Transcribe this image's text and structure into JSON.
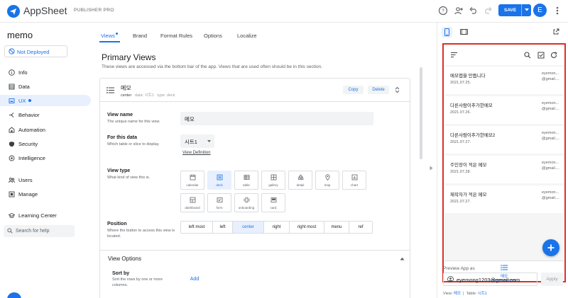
{
  "header": {
    "app_name": "AppSheet",
    "plan": "PUBLISHER PRO",
    "save_label": "SAVE",
    "avatar_letter": "E",
    "brand_color": "#1a73e8"
  },
  "sidebar": {
    "app_title": "memo",
    "deploy_status": "Not Deployed",
    "items": [
      {
        "label": "Info",
        "icon": "info-icon"
      },
      {
        "label": "Data",
        "icon": "data-icon"
      },
      {
        "label": "UX",
        "icon": "ux-icon",
        "active": true
      },
      {
        "label": "Behavior",
        "icon": "behavior-icon"
      },
      {
        "label": "Automation",
        "icon": "automation-icon"
      },
      {
        "label": "Security",
        "icon": "shield-icon"
      },
      {
        "label": "Intelligence",
        "icon": "intelligence-icon"
      },
      {
        "label": "Users",
        "icon": "users-icon"
      },
      {
        "label": "Manage",
        "icon": "manage-icon"
      },
      {
        "label": "Learning Center",
        "icon": "learning-icon"
      }
    ],
    "search_placeholder": "Search for help"
  },
  "tabs": [
    {
      "label": "Views"
    },
    {
      "label": "Brand"
    },
    {
      "label": "Format Rules"
    },
    {
      "label": "Options"
    },
    {
      "label": "Localize"
    }
  ],
  "main": {
    "title": "Primary Views",
    "description": "These views are accessed via the bottom bar of the app. Views that are used often should be in this section.",
    "view": {
      "name": "메모",
      "position": "center",
      "data_label": "data:",
      "data_value": "시트1",
      "type_label": "type:",
      "type_value": "deck",
      "copy_label": "Copy",
      "delete_label": "Delete"
    },
    "fields": {
      "view_name_label": "View name",
      "view_name_help": "The unique name for this view.",
      "view_name_value": "메모",
      "for_data_label": "For this data",
      "for_data_help": "Which table or slice to display.",
      "for_data_value": "시트1",
      "view_definition": "View Definition",
      "view_type_label": "View type",
      "view_type_help": "What kind of view this is.",
      "position_label": "Position",
      "position_help": "Where the button to access this view is located."
    },
    "view_types": [
      {
        "label": "calendar",
        "icon": "calendar-icon"
      },
      {
        "label": "deck",
        "icon": "deck-icon",
        "selected": true
      },
      {
        "label": "table",
        "icon": "table-icon"
      },
      {
        "label": "gallery",
        "icon": "gallery-icon"
      },
      {
        "label": "detail",
        "icon": "detail-icon"
      },
      {
        "label": "map",
        "icon": "map-icon"
      },
      {
        "label": "chart",
        "icon": "chart-icon"
      },
      {
        "label": "dashboard",
        "icon": "dashboard-icon"
      },
      {
        "label": "form",
        "icon": "form-icon"
      },
      {
        "label": "onboarding",
        "icon": "onboarding-icon"
      },
      {
        "label": "card",
        "icon": "card-icon"
      }
    ],
    "positions": [
      "left most",
      "left",
      "center",
      "right",
      "right most",
      "menu",
      "ref"
    ],
    "selected_position": "center",
    "view_options": {
      "title": "View Options",
      "sort_label": "Sort by",
      "sort_help": "Sort the rows by one or more columns.",
      "add_label": "Add"
    }
  },
  "preview": {
    "records": [
      {
        "title": "메모앱을 만듭니다",
        "date": "2021.07.25.",
        "email1": "eyemon...",
        "email2": "@gmail...."
      },
      {
        "title": "다른사람이추가한메모",
        "date": "2021.07.26.",
        "email1": "eyemon...",
        "email2": "@gmail...."
      },
      {
        "title": "다른사람이추가한메모2",
        "date": "2021.07.27.",
        "email1": "eyemon...",
        "email2": "@gmail...."
      },
      {
        "title": "주인장이 적은 메모",
        "date": "2021.07.28.",
        "email1": "eyemon...",
        "email2": "@gmail...."
      },
      {
        "title": "제작자가 적은 메모",
        "date": "2021.07.27.",
        "email1": "eyemon...",
        "email2": "@gmail...."
      }
    ],
    "bottom_tab": "메모",
    "preview_as_label": "Preview App as",
    "preview_email": "eyemong1203@gmail.com",
    "apply_label": "Apply",
    "footer_view_label": "View:",
    "footer_view_value": "메모",
    "footer_sep": "|",
    "footer_table_label": "Table:",
    "footer_table_value": "시트1",
    "highlight_color": "#d93025"
  }
}
